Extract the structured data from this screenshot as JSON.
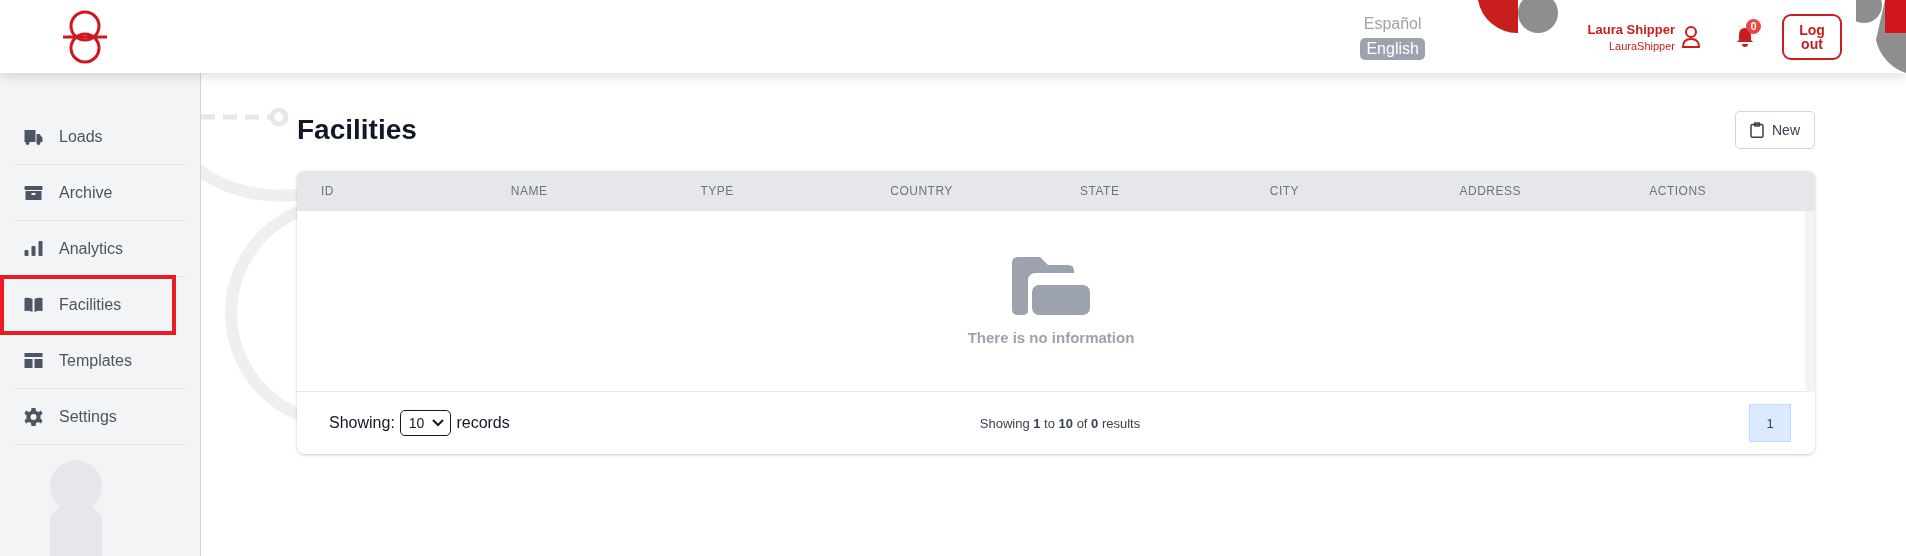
{
  "header": {
    "languages": [
      {
        "label": "Español",
        "selected": false
      },
      {
        "label": "English",
        "selected": true
      }
    ],
    "user": {
      "name": "Laura Shipper",
      "username": "LauraShipper"
    },
    "notifications": {
      "count": "0"
    },
    "logout": "Log out"
  },
  "sidebar": {
    "items": [
      {
        "label": "Loads",
        "selected": false
      },
      {
        "label": "Archive",
        "selected": false
      },
      {
        "label": "Analytics",
        "selected": false
      },
      {
        "label": "Facilities",
        "selected": true
      },
      {
        "label": "Templates",
        "selected": false
      },
      {
        "label": "Settings",
        "selected": false
      }
    ]
  },
  "page": {
    "title": "Facilities",
    "new_button": "New"
  },
  "table": {
    "columns": [
      "ID",
      "NAME",
      "TYPE",
      "COUNTRY",
      "STATE",
      "CITY",
      "ADDRESS",
      "ACTIONS"
    ],
    "empty_message": "There is no information",
    "footer": {
      "showing_label": "Showing:",
      "page_size": "10",
      "records_label": "records",
      "summary": "Showing **1** to **10** of **0** results",
      "pages": [
        {
          "label": "1",
          "selected": true
        }
      ]
    }
  }
}
